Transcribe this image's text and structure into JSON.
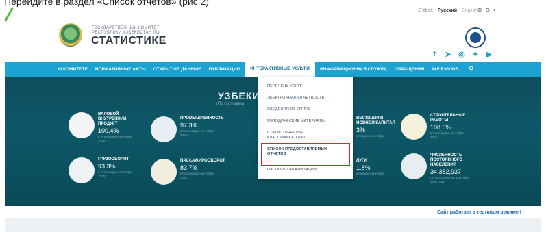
{
  "document": {
    "caption": "Перейдите в раздел «Список отчетов» (рис 2)"
  },
  "topbar": {
    "languages": [
      "O'zbek",
      "Русский",
      "English"
    ],
    "active_language": "Русский",
    "tools": [
      "zoom-in-icon",
      "zoom-out-icon",
      "contrast-icon"
    ]
  },
  "header": {
    "org_line1": "ГОСУДАРСТВЕННЫЙ КОМИТЕТ",
    "org_line2": "РЕСПУБЛИКИ УЗБЕКИСТАН ПО",
    "org_title": "СТАТИСТИКЕ",
    "social": [
      "facebook-icon",
      "telegram-icon",
      "instagram-icon",
      "twitter-icon",
      "youtube-icon"
    ]
  },
  "nav": {
    "items": [
      "О КОМИТЕТЕ",
      "НОРМАТИВНЫЕ АКТЫ",
      "ОТКРЫТЫЕ ДАННЫЕ",
      "ПУБЛИКАЦИИ",
      "ИНТЕРАКТИВНЫЕ УСЛУГИ",
      "ИНФОРМАЦИОННАЯ СЛУЖБА",
      "ОБРАЩЕНИЯ",
      "IMF E-GDDS"
    ],
    "active": "ИНТЕРАКТИВНЫЕ УСЛУГИ"
  },
  "hero": {
    "title": "УЗБЕКИ",
    "subtitle": "(По состоянии",
    "stats": [
      {
        "name": "ВАЛОВОЙ\nВНУТРЕННИЙ\nПРОДУКТ",
        "value": "100,4%",
        "note": "в % к январю-сентябрю\n2019 г."
      },
      {
        "name": "ПРОМЫШЛЕННОСТЬ",
        "value": "97.3%",
        "note": "в % к январю-сентябрю\n2019 г."
      },
      {
        "name": "ВЕСТИЦИИ В\nНОВНОЙ КАПИТАЛ",
        "value": "3%",
        "note": "к январю-сентябрю"
      },
      {
        "name": "СТРОИТЕЛЬНЫЕ\nРАБОТЫ",
        "value": "108.6%",
        "note": "в % к январю-сентябрю\n2019 г."
      },
      {
        "name": "ГРУЗООБОРОТ",
        "value": "93,3%",
        "note": "в % к январю-сентябрю\n2019 г."
      },
      {
        "name": "ПАССАЖИРООБОРОТ",
        "value": "83.7%",
        "note": "в % к январю-сентябрю\n2019 г."
      },
      {
        "name": "ЛУГИ",
        "value": "1.8%",
        "note": "к январю-сентябрю"
      },
      {
        "name": "ЧИСЛЕННОСТЬ\nПОСТОЯННОГО\nНАСЕЛЕНИЯ",
        "value": "34,382,937",
        "note": "По состоянию на 1 октября\n2020 года"
      }
    ]
  },
  "dropdown": {
    "items": [
      "ПЕРЕЧЕНЬ УСЛУГ",
      "ЭЛЕКТРОННАЯ ОТЧЕТНОСТЬ",
      "СВЕДЕНИЯ ИЗ ЕГРПО",
      "МЕТОДИЧЕСКИЕ МАТЕРИАЛЫ",
      "СТАТИСТИЧЕСКИЕ КЛАССИФИКАТОРЫ",
      "СПИСОК ПРЕДОСТАВЛЯЕМЫХ ОТЧЕТОВ",
      "ПАСПОРТ ОРГАНИЗАЦИИ"
    ],
    "highlighted": "СПИСОК ПРЕДОСТАВЛЯЕМЫХ ОТЧЕТОВ"
  },
  "footer": {
    "test_mode_note": "Сайт работает в тестовом режиме !"
  },
  "colors": {
    "nav_bg": "#1da3d1",
    "hero_bg": "#0d5867",
    "highlight": "#d12a2a",
    "accent_blue": "#1565a8"
  }
}
